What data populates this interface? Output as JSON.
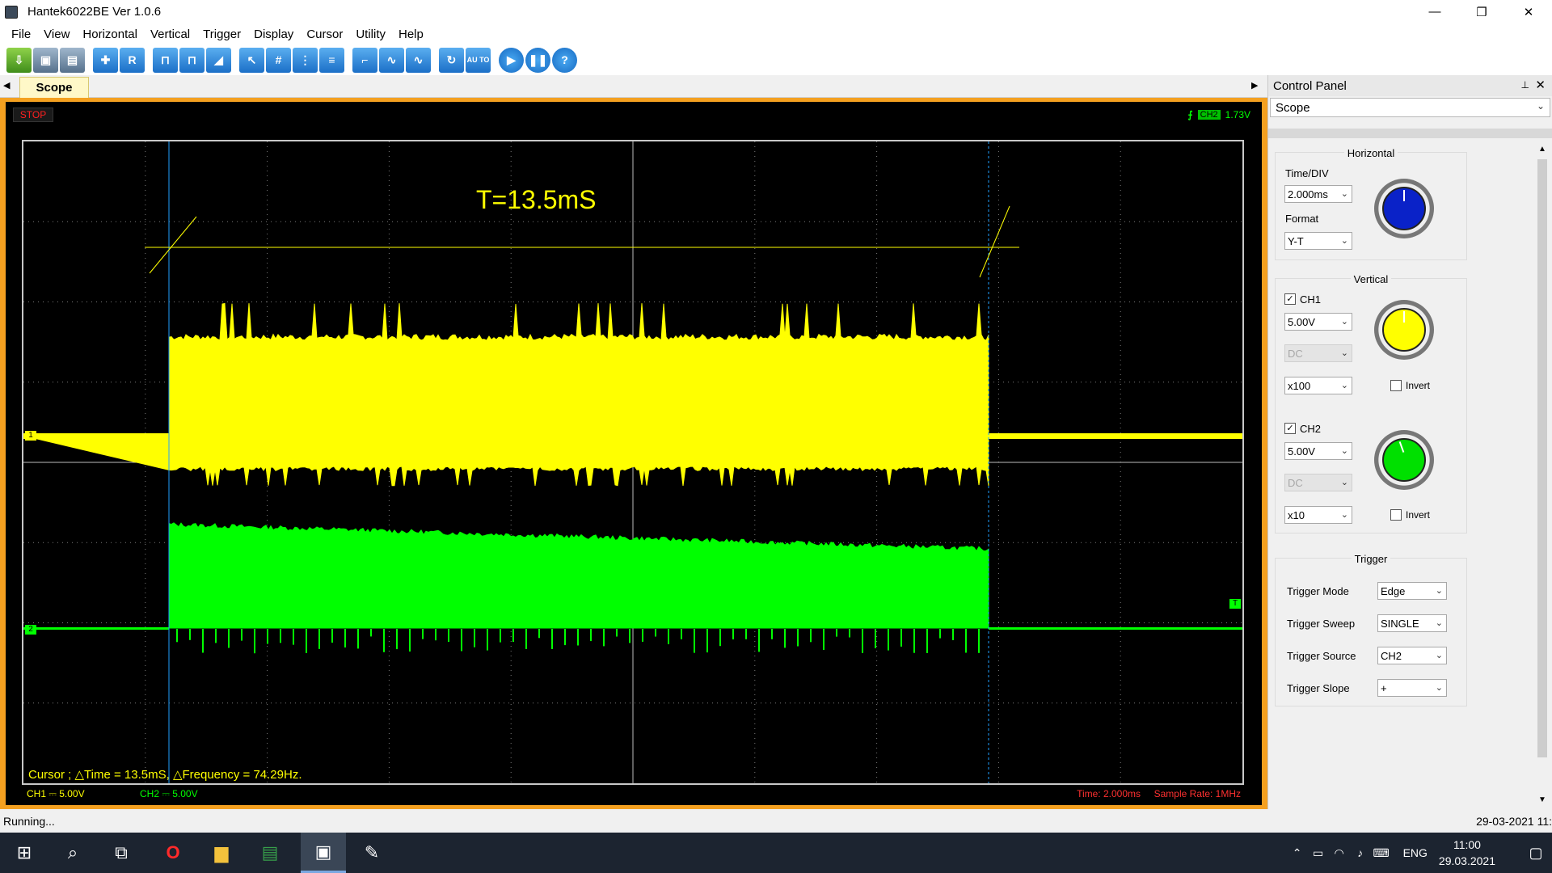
{
  "window": {
    "title": "Hantek6022BE Ver 1.0.6",
    "min": "—",
    "max": "❐",
    "close": "✕"
  },
  "menu": [
    "File",
    "View",
    "Horizontal",
    "Vertical",
    "Trigger",
    "Display",
    "Cursor",
    "Utility",
    "Help"
  ],
  "toolbar": {
    "icons": [
      "open-icon",
      "save-icon",
      "print-icon",
      "zoom-icon",
      "reference-icon",
      "pulse-icon",
      "pulse-pair-icon",
      "ramp-icon",
      "select-cursor-icon",
      "grid-icon",
      "vertical-cursor-icon",
      "horizontal-cursor-icon",
      "step-icon",
      "sine-icon",
      "wave-icon",
      "refresh-icon",
      "auto-icon",
      "run-icon",
      "pause-icon",
      "help-icon"
    ],
    "r_label": "R",
    "auto_label": "AU TO",
    "help_label": "?"
  },
  "tabs": {
    "scope": "Scope",
    "left_arrow": "◀",
    "right_arrow": "▶"
  },
  "scope": {
    "run_state": "STOP",
    "trigger_edge": "⨍",
    "trigger_channel": "CH2",
    "trigger_level": "1.73V",
    "measurement": "T=13.5mS",
    "cursor_readout": "Cursor ; △Time = 13.5mS, △Frequency = 74.29Hz.",
    "ch1_marker": "1",
    "ch2_marker": "2",
    "trig_marker": "T",
    "ch1_status": "CH1 ⎓  5.00V",
    "ch2_status": "CH2 ⎓  5.00V",
    "time_status": "Time: 2.000ms",
    "sample_rate": "Sample Rate: 1MHz",
    "colors": {
      "ch1": "#ffff00",
      "ch2": "#00ff00",
      "cursor": "#1fa0ff",
      "grid": "#7a7a7a"
    }
  },
  "control_panel": {
    "title": "Control Panel",
    "pin": "⊥",
    "close": "✕",
    "mode": "Scope",
    "horizontal": {
      "title": "Horizontal",
      "time_label": "Time/DIV",
      "time_value": "2.000ms",
      "format_label": "Format",
      "format_value": "Y-T"
    },
    "vertical": {
      "title": "Vertical",
      "ch1": {
        "label": "CH1",
        "volts": "5.00V",
        "coupling": "DC",
        "probe": "x100",
        "invert": "Invert"
      },
      "ch2": {
        "label": "CH2",
        "volts": "5.00V",
        "coupling": "DC",
        "probe": "x10",
        "invert": "Invert"
      }
    },
    "trigger": {
      "title": "Trigger",
      "mode_label": "Trigger Mode",
      "mode_value": "Edge",
      "sweep_label": "Trigger Sweep",
      "sweep_value": "SINGLE",
      "source_label": "Trigger Source",
      "source_value": "CH2",
      "slope_label": "Trigger Slope",
      "slope_value": "+"
    }
  },
  "statusbar": {
    "left": "Running...",
    "right": "29-03-2021  11:"
  },
  "taskbar": {
    "icons": [
      "windows-start-icon",
      "search-icon",
      "task-view-icon",
      "opera-icon",
      "file-explorer-icon",
      "spreadsheet-icon",
      "oscilloscope-app-icon",
      "paint-app-icon"
    ],
    "tray_icons": [
      "chevron-up-icon",
      "battery-icon",
      "wifi-icon",
      "volume-icon",
      "keyboard-icon"
    ],
    "lang": "ENG",
    "time": "11:00",
    "date": "29.03.2021"
  }
}
